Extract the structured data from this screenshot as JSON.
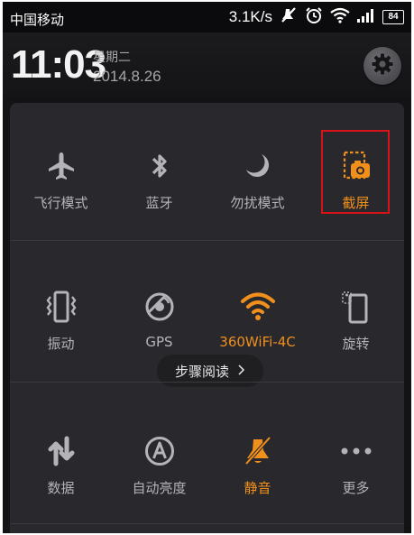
{
  "status_bar": {
    "carrier": "中国移动",
    "speed": "3.1K/s",
    "battery": "84",
    "icons": [
      "no-notification-icon",
      "alarm-icon",
      "wifi-icon",
      "signal-icon",
      "battery-icon"
    ]
  },
  "header": {
    "time": "11:03",
    "weekday": "星期二",
    "date": "2014.8.26",
    "settings_icon": "gear-icon"
  },
  "toggles": {
    "row1": [
      {
        "label": "飞行模式",
        "icon": "airplane-icon",
        "active": false
      },
      {
        "label": "蓝牙",
        "icon": "bluetooth-icon",
        "active": false
      },
      {
        "label": "勿扰模式",
        "icon": "moon-icon",
        "active": false
      },
      {
        "label": "截屏",
        "icon": "screenshot-icon",
        "active": true
      }
    ],
    "row2": [
      {
        "label": "振动",
        "icon": "vibrate-icon",
        "active": false
      },
      {
        "label": "GPS",
        "icon": "gps-icon",
        "active": false
      },
      {
        "label": "360WiFi-4C",
        "icon": "wifi-icon",
        "active": true
      },
      {
        "label": "旋转",
        "icon": "rotate-icon",
        "active": false
      }
    ],
    "row3": [
      {
        "label": "数据",
        "icon": "data-arrows-icon",
        "active": false
      },
      {
        "label": "自动亮度",
        "icon": "auto-brightness-icon",
        "active": false
      },
      {
        "label": "静音",
        "icon": "mute-bell-icon",
        "active": true
      },
      {
        "label": "更多",
        "icon": "more-dots-icon",
        "active": false
      }
    ]
  },
  "guide_pill": {
    "label": "步骤阅读",
    "icon": "chevron-right-icon"
  },
  "colors": {
    "accent": "#f18f1d",
    "highlight_border": "#d8141a",
    "panel": "#29292d",
    "icon_inactive": "#b4b4b8"
  }
}
